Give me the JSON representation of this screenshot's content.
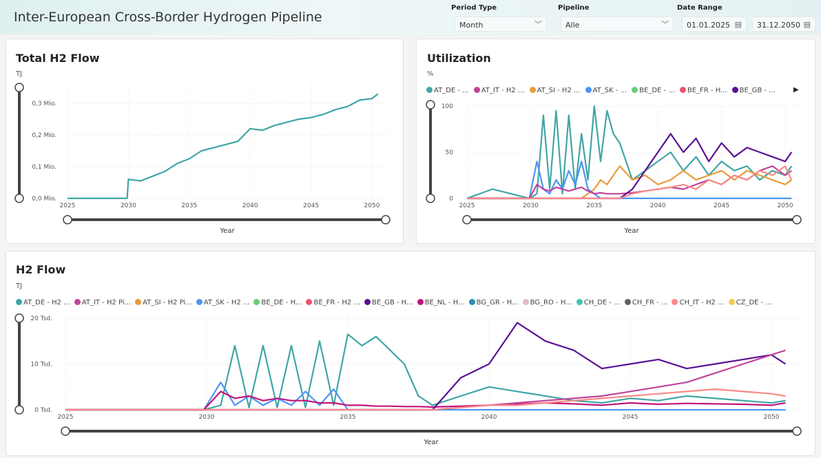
{
  "header": {
    "title": "Inter-European Cross-Border Hydrogen Pipeline",
    "period_type": {
      "label": "Period Type",
      "value": "Month"
    },
    "pipeline": {
      "label": "Pipeline",
      "value": "Alle"
    },
    "date_range": {
      "label": "Date Range",
      "start": "01.01.2025",
      "end": "31.12.2050"
    }
  },
  "colors": {
    "AT_DE": "#41a5a5",
    "AT_IT": "#c0439a",
    "AT_SI": "#ea9a3a",
    "AT_SK": "#4d94f5",
    "BE_DE": "#6cca78",
    "BE_FR": "#f0506a",
    "BE_GB": "#5a1094",
    "BE_NL": "#c2147c",
    "BG_GR": "#2e8fb5",
    "BG_RO": "#e2bcc0",
    "CH_DE": "#3fc4b4",
    "CH_FR": "#5a6468",
    "CH_IT": "#f98a86",
    "CZ_DE": "#f2cb50"
  },
  "chart_data": [
    {
      "id": "total",
      "type": "line",
      "title": "Total H2 Flow",
      "ylabel": "TJ",
      "xlabel": "Year",
      "ylim": [
        0,
        350000
      ],
      "yticks": [
        "0,0 Mio.",
        "0,1 Mio.",
        "0,2 Mio.",
        "0,3 Mio."
      ],
      "ytick_values": [
        0,
        100000,
        200000,
        300000
      ],
      "xticks": [
        "2025",
        "2030",
        "2035",
        "2040",
        "2045",
        "2050"
      ],
      "x": [
        2025,
        2026,
        2027,
        2028,
        2029,
        2029.9,
        2030,
        2031,
        2032,
        2033,
        2034,
        2035,
        2036,
        2037,
        2038,
        2039,
        2040,
        2041,
        2042,
        2043,
        2044,
        2045,
        2046,
        2047,
        2048,
        2049,
        2050,
        2050.5
      ],
      "series": [
        {
          "key": "AT_DE",
          "values": [
            0,
            0,
            0,
            0,
            0,
            0,
            60000,
            55000,
            70000,
            85000,
            110000,
            125000,
            150000,
            160000,
            170000,
            180000,
            220000,
            215000,
            230000,
            240000,
            250000,
            255000,
            265000,
            280000,
            290000,
            310000,
            315000,
            330000
          ]
        }
      ]
    },
    {
      "id": "util",
      "type": "line",
      "title": "Utilization",
      "ylabel": "%",
      "xlabel": "Year",
      "ylim": [
        0,
        100
      ],
      "yticks": [
        "0",
        "50",
        "100"
      ],
      "ytick_values": [
        0,
        50,
        100
      ],
      "xticks": [
        "2025",
        "2030",
        "2035",
        "2040",
        "2045",
        "2050"
      ],
      "legend": [
        "AT_DE - ...",
        "AT_IT - H2 ...",
        "AT_SI - H2 ...",
        "AT_SK - ...",
        "BE_DE - ...",
        "BE_FR - H...",
        "BE_GB - ..."
      ],
      "legend_keys": [
        "AT_DE",
        "AT_IT",
        "AT_SI",
        "AT_SK",
        "BE_DE",
        "BE_FR",
        "BE_GB"
      ],
      "x": [
        2025,
        2027,
        2029.9,
        2030.5,
        2031,
        2031.5,
        2032,
        2032.5,
        2033,
        2033.5,
        2034,
        2034.5,
        2035,
        2035.5,
        2036,
        2036.5,
        2037,
        2038,
        2039,
        2040,
        2041,
        2042,
        2043,
        2044,
        2045,
        2046,
        2047,
        2048,
        2049,
        2050,
        2050.5
      ],
      "series": [
        {
          "key": "AT_DE",
          "values": [
            0,
            10,
            0,
            5,
            90,
            10,
            95,
            5,
            90,
            10,
            70,
            20,
            100,
            40,
            95,
            70,
            60,
            20,
            30,
            40,
            50,
            30,
            45,
            25,
            40,
            30,
            35,
            20,
            30,
            25,
            35
          ]
        },
        {
          "key": "AT_SI",
          "values": [
            0,
            0,
            0,
            0,
            0,
            0,
            0,
            0,
            0,
            0,
            0,
            5,
            10,
            20,
            15,
            25,
            35,
            20,
            25,
            15,
            20,
            30,
            20,
            25,
            30,
            20,
            30,
            25,
            20,
            15,
            20
          ]
        },
        {
          "key": "AT_SK",
          "values": [
            0,
            0,
            0,
            40,
            10,
            5,
            20,
            10,
            30,
            15,
            40,
            10,
            5,
            0,
            0,
            0,
            0,
            0,
            0,
            0,
            0,
            0,
            0,
            0,
            0,
            0,
            0,
            0,
            0,
            0,
            0
          ]
        },
        {
          "key": "AT_IT",
          "values": [
            0,
            0,
            0,
            15,
            10,
            8,
            12,
            10,
            8,
            10,
            12,
            8,
            5,
            6,
            5,
            5,
            5,
            6,
            8,
            10,
            12,
            10,
            15,
            20,
            15,
            25,
            20,
            30,
            35,
            25,
            30
          ]
        },
        {
          "key": "BE_GB",
          "values": [
            0,
            0,
            0,
            0,
            0,
            0,
            0,
            0,
            0,
            0,
            0,
            0,
            0,
            0,
            0,
            0,
            0,
            10,
            30,
            50,
            70,
            50,
            65,
            40,
            60,
            45,
            55,
            50,
            45,
            40,
            50
          ]
        },
        {
          "key": "CH_IT",
          "values": [
            0,
            0,
            0,
            0,
            0,
            0,
            0,
            0,
            0,
            0,
            0,
            0,
            0,
            0,
            0,
            0,
            0,
            5,
            8,
            10,
            12,
            15,
            10,
            20,
            15,
            25,
            20,
            30,
            25,
            35,
            20
          ]
        }
      ]
    },
    {
      "id": "flow",
      "type": "line",
      "title": "H2 Flow",
      "ylabel": "TJ",
      "xlabel": "Year",
      "ylim": [
        0,
        20000
      ],
      "yticks": [
        "0 Tsd.",
        "10 Tsd.",
        "20 Tsd."
      ],
      "ytick_values": [
        0,
        10000,
        20000
      ],
      "xticks": [
        "2025",
        "2030",
        "2035",
        "2040",
        "2045",
        "2050"
      ],
      "legend": [
        "AT_DE - H2 ...",
        "AT_IT - H2 Pi...",
        "AT_SI - H2 Pi...",
        "AT_SK - H2 ...",
        "BE_DE - H...",
        "BE_FR - H2 ...",
        "BE_GB - H...",
        "BE_NL - H...",
        "BG_GR - H...",
        "BG_RO - H...",
        "CH_DE - ...",
        "CH_FR - ...",
        "CH_IT - H2 ...",
        "CZ_DE - ..."
      ],
      "legend_keys": [
        "AT_DE",
        "AT_IT",
        "AT_SI",
        "AT_SK",
        "BE_DE",
        "BE_FR",
        "BE_GB",
        "BE_NL",
        "BG_GR",
        "BG_RO",
        "CH_DE",
        "CH_FR",
        "CH_IT",
        "CZ_DE"
      ],
      "x": [
        2025,
        2029.9,
        2030.5,
        2031,
        2031.5,
        2032,
        2032.5,
        2033,
        2033.5,
        2034,
        2034.5,
        2035,
        2035.5,
        2036,
        2036.5,
        2037,
        2037.5,
        2038,
        2039,
        2040,
        2041,
        2042,
        2043,
        2044,
        2045,
        2046,
        2047,
        2048,
        2049,
        2050,
        2050.5
      ],
      "series": [
        {
          "key": "AT_DE",
          "values": [
            0,
            0,
            1000,
            14000,
            500,
            14000,
            500,
            14000,
            500,
            15000,
            1000,
            16500,
            14000,
            16000,
            13000,
            10000,
            3000,
            1000,
            3000,
            5000,
            4000,
            3000,
            2000,
            1500,
            2500,
            2000,
            3000,
            2500,
            2000,
            1500,
            2000
          ]
        },
        {
          "key": "AT_SK",
          "values": [
            0,
            0,
            6000,
            1000,
            3000,
            1000,
            2500,
            1000,
            4000,
            1000,
            4500,
            0,
            0,
            0,
            0,
            0,
            0,
            0,
            0,
            0,
            0,
            0,
            0,
            0,
            0,
            0,
            0,
            0,
            0,
            0,
            0
          ]
        },
        {
          "key": "BE_NL",
          "values": [
            0,
            0,
            4000,
            2500,
            3000,
            2000,
            2500,
            2000,
            2000,
            1500,
            1500,
            1000,
            1000,
            800,
            800,
            700,
            700,
            600,
            800,
            1000,
            1200,
            1500,
            1300,
            1000,
            1500,
            1200,
            1400,
            1300,
            1200,
            1000,
            1500
          ]
        },
        {
          "key": "BE_GB",
          "values": [
            0,
            0,
            0,
            0,
            0,
            0,
            0,
            0,
            0,
            0,
            0,
            0,
            0,
            0,
            0,
            0,
            0,
            0,
            7000,
            10000,
            19000,
            15000,
            13000,
            9000,
            10000,
            11000,
            9000,
            10000,
            11000,
            12000,
            10000
          ]
        },
        {
          "key": "AT_IT",
          "values": [
            0,
            0,
            0,
            0,
            0,
            0,
            0,
            0,
            0,
            0,
            0,
            0,
            0,
            0,
            0,
            0,
            0,
            0,
            500,
            1000,
            1500,
            2000,
            2500,
            3000,
            4000,
            5000,
            6000,
            8000,
            10000,
            12000,
            13000
          ]
        },
        {
          "key": "CH_IT",
          "values": [
            0,
            0,
            0,
            0,
            0,
            0,
            0,
            0,
            0,
            0,
            0,
            0,
            0,
            0,
            0,
            0,
            0,
            0,
            500,
            1000,
            1000,
            1500,
            2000,
            2500,
            3000,
            3500,
            4000,
            4500,
            4000,
            3500,
            3000
          ]
        }
      ]
    }
  ]
}
